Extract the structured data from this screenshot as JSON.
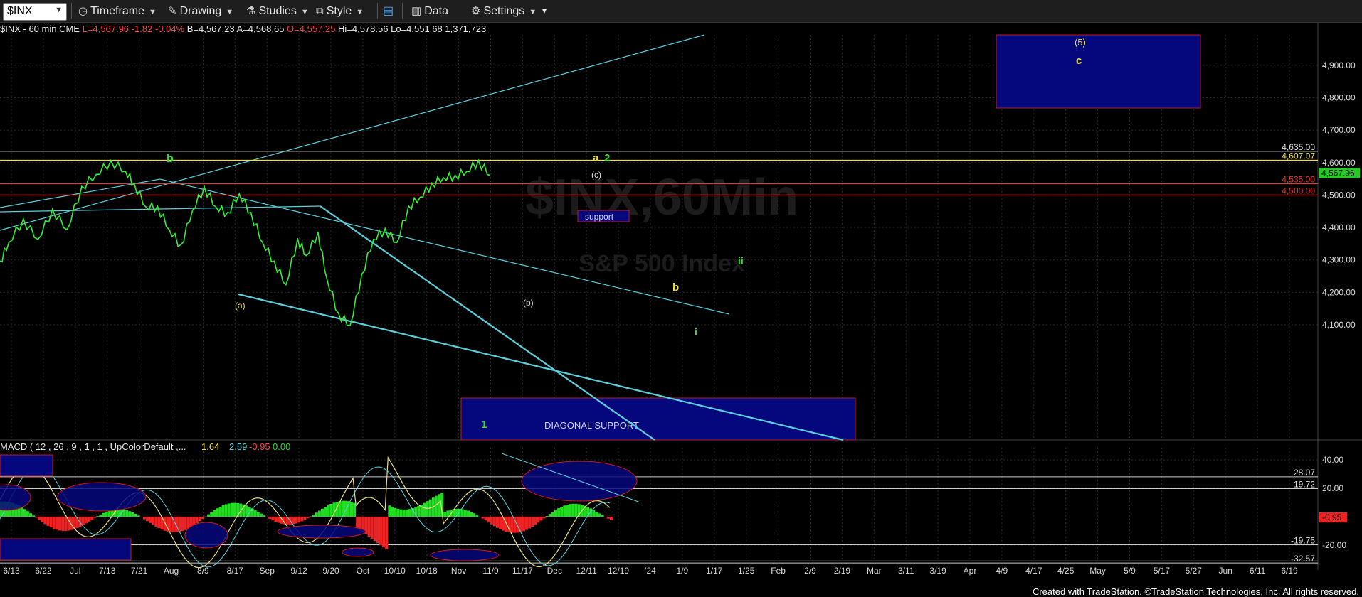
{
  "toolbar": {
    "symbol": "$INX",
    "timeframe": "Timeframe",
    "drawing": "Drawing",
    "studies": "Studies",
    "style": "Style",
    "data": "Data",
    "settings": "Settings"
  },
  "info_bar": {
    "title": "$INX - 60 min  CME",
    "last": "L=4,567.96",
    "change": "-1.82",
    "pct": "-0.04%",
    "bid": "B=4,567.23",
    "ask": "A=4,568.65",
    "open": "O=4,557.25",
    "high": "Hi=4,578.56",
    "low": "Lo=4,551.68",
    "volume": "1,371,723"
  },
  "watermark": {
    "main": "$INX,60Min",
    "sub": "S&P 500 Index"
  },
  "macd_header": {
    "label": "MACD ( 12 , 26 , 9 , 1 , 1 , UpColorDefault ,...",
    "v1": "1.64",
    "v2": "2.59",
    "v3": "-0.95",
    "v4": "0.00"
  },
  "colors": {
    "background": "#000000",
    "price": "#33ee33",
    "trendline": "#5ad0dc",
    "box_fill": "#05077c",
    "box_edge": "#d01818",
    "label_yellow": "#f0e040",
    "label_green": "#33dd33",
    "axis_text": "#d8d8d8",
    "macd_line": "#e8e088",
    "hist_pos": "#22dd22",
    "hist_neg": "#ee2222",
    "last_price_bg": "#22cc22",
    "macd_last_bg": "#ee2222"
  },
  "chart_data": {
    "type": "line",
    "title": "$INX,60Min",
    "subtitle": "S&P 500 Index",
    "x_ticks": [
      "6/13",
      "6/22",
      "Jul",
      "7/13",
      "7/21",
      "Aug",
      "8/9",
      "8/17",
      "Sep",
      "9/12",
      "9/20",
      "Oct",
      "10/10",
      "10/18",
      "Nov",
      "11/9",
      "11/17",
      "Dec",
      "12/11",
      "12/19",
      "'24",
      "1/9",
      "1/17",
      "1/25",
      "Feb",
      "2/9",
      "2/19",
      "Mar",
      "3/11",
      "3/19",
      "Apr",
      "4/9",
      "4/17",
      "4/25",
      "May",
      "5/9",
      "5/17",
      "5/27",
      "Jun",
      "6/11",
      "6/19"
    ],
    "y_ticks": [
      4100,
      4200,
      4300,
      4400,
      4500,
      4600,
      4700,
      4800,
      4900
    ],
    "y_tick_labels": [
      "4,100.00",
      "4,200.00",
      "4,300.00",
      "4,400.00",
      "4,500.00",
      "4,600.00",
      "4,700.00",
      "4,800.00",
      "4,900.00"
    ],
    "ylim": [
      4010,
      5000
    ],
    "series": [
      {
        "x": [
          0,
          0.3,
          0.8,
          1.3,
          1.8,
          2.3,
          2.8,
          3.3,
          3.8,
          4.3,
          4.6,
          5.0,
          5.4,
          5.8,
          6.2,
          6.6,
          7.0,
          7.4,
          7.8,
          8.2,
          8.6,
          9.0,
          9.4,
          9.8,
          10.2,
          10.5,
          10.9,
          11.2,
          11.6,
          12.0,
          12.4,
          12.8,
          13.2,
          13.6,
          14.0,
          14.4,
          14.8,
          15.2,
          15.6,
          16.0,
          16.4,
          16.8
        ],
        "y": [
          4290,
          4360,
          4420,
          4370,
          4450,
          4400,
          4520,
          4570,
          4600,
          4580,
          4530,
          4470,
          4460,
          4400,
          4340,
          4460,
          4520,
          4470,
          4440,
          4510,
          4440,
          4360,
          4290,
          4230,
          4360,
          4320,
          4380,
          4250,
          4130,
          4105,
          4250,
          4370,
          4390,
          4360,
          4460,
          4500,
          4530,
          4560,
          4555,
          4580,
          4600,
          4568
        ]
      }
    ],
    "horizontal_levels": [
      {
        "value": 4635.0,
        "label": "4,635.00",
        "color": "#dddddd"
      },
      {
        "value": 4607.07,
        "label": "4,607.07",
        "color": "#f0e040"
      },
      {
        "value": 4535.0,
        "label": "4,535.00",
        "color": "#ee3333"
      },
      {
        "value": 4500.0,
        "label": "4,500.00",
        "color": "#ee3333"
      }
    ],
    "last_price": {
      "value": 4567.96,
      "label": "4,567.96"
    },
    "annotations": [
      {
        "text": "support",
        "kind": "box"
      },
      {
        "text": "DIAGONAL SUPPORT",
        "kind": "box"
      },
      {
        "text": "(5)",
        "color": "yellow"
      },
      {
        "text": "c",
        "color": "yellow"
      },
      {
        "text": "a",
        "color": "yellow"
      },
      {
        "text": "2",
        "color": "green"
      },
      {
        "text": "b",
        "color": "green"
      },
      {
        "text": "b",
        "color": "yellow"
      },
      {
        "text": "ii",
        "color": "green"
      },
      {
        "text": "i",
        "color": "green"
      },
      {
        "text": "(c)",
        "color": "white"
      },
      {
        "text": "(b)",
        "color": "white"
      },
      {
        "text": "(a)",
        "color": "white"
      },
      {
        "text": "1",
        "color": "green"
      }
    ],
    "macd": {
      "y_ticks": [
        40,
        20
      ],
      "y_tick_labels": [
        "40.00",
        "20.00",
        "-20.00"
      ],
      "levels": [
        {
          "value": 28.07,
          "label": "28.07"
        },
        {
          "value": 19.72,
          "label": "19.72"
        },
        {
          "value": -19.75,
          "label": "-19.75"
        },
        {
          "value": -32.57,
          "label": "-32.57"
        }
      ],
      "last": {
        "value": -0.95,
        "label": "-0.95"
      }
    }
  },
  "footer": "Created with TradeStation. ©TradeStation Technologies, Inc. All rights reserved."
}
